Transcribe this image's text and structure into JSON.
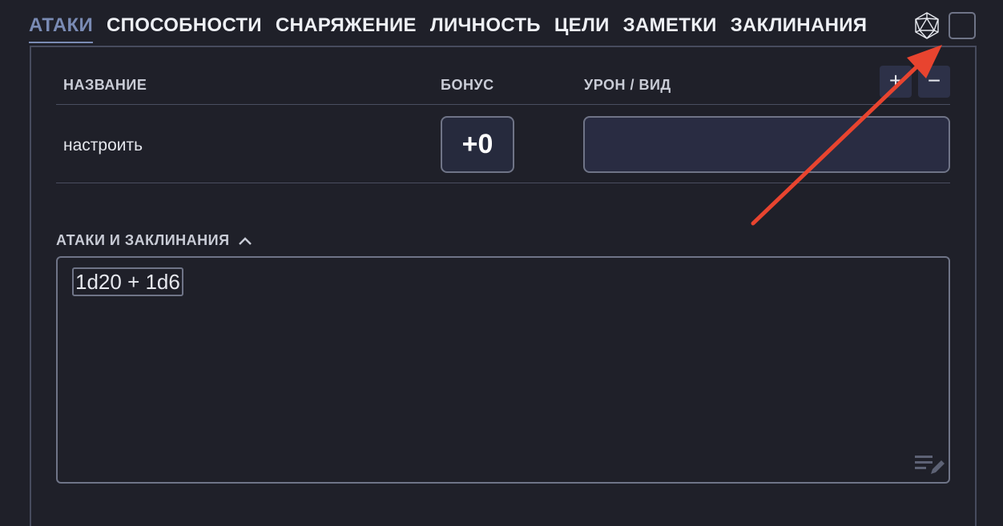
{
  "tabs": [
    "АТАКИ",
    "СПОСОБНОСТИ",
    "СНАРЯЖЕНИЕ",
    "ЛИЧНОСТЬ",
    "ЦЕЛИ",
    "ЗАМЕТКИ",
    "ЗАКЛИНАНИЯ"
  ],
  "active_tab": "АТАКИ",
  "attacks_table": {
    "headers": {
      "name": "НАЗВАНИЕ",
      "bonus": "БОНУС",
      "damage": "УРОН / ВИД"
    },
    "add_label": "+",
    "remove_label": "−",
    "rows": [
      {
        "name": "настроить",
        "bonus": "+0",
        "damage": ""
      }
    ]
  },
  "notes_section": {
    "title": "АТАКИ И ЗАКЛИНАНИЯ",
    "chip": "1d20 + 1d6"
  },
  "icons": {
    "die": "d20-die-icon",
    "collapse": "chevron-up-icon",
    "edit": "edit-notes-icon"
  },
  "colors": {
    "background": "#1f2029",
    "active_tab": "#7a8bb4",
    "annotation_arrow": "#e8442f"
  }
}
